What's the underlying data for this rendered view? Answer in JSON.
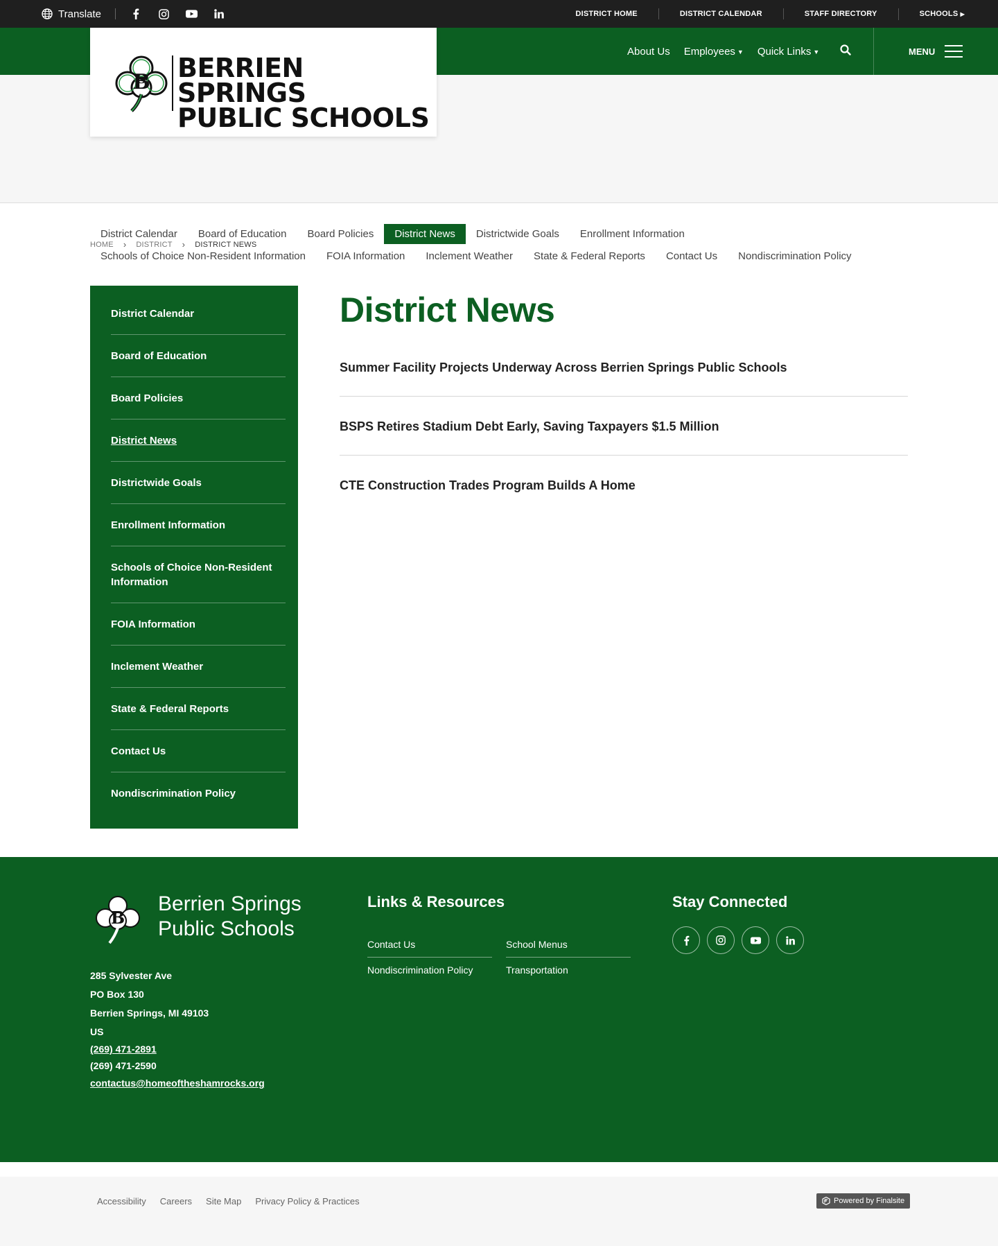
{
  "topbar": {
    "translate_label": "Translate",
    "social_icons": [
      "facebook-icon",
      "instagram-icon",
      "youtube-icon",
      "linkedin-icon"
    ],
    "links": [
      "DISTRICT HOME",
      "DISTRICT CALENDAR",
      "STAFF DIRECTORY",
      "SCHOOLS"
    ]
  },
  "header": {
    "nav": [
      "About Us",
      "Employees",
      "Quick Links"
    ],
    "menu_label": "MENU"
  },
  "logo": {
    "line1": "BERRIEN SPRINGS",
    "line2": "PUBLIC SCHOOLS"
  },
  "subnav": {
    "row1": [
      "District Calendar",
      "Board of Education",
      "Board Policies",
      "District News",
      "Districtwide Goals",
      "Enrollment Information"
    ],
    "row2": [
      "Schools of Choice Non-Resident Information",
      "FOIA Information",
      "Inclement Weather",
      "State & Federal Reports",
      "Contact Us",
      "Nondiscrimination Policy"
    ]
  },
  "breadcrumb": [
    "HOME",
    "DISTRICT",
    "DISTRICT NEWS"
  ],
  "sidebar": {
    "items": [
      "District Calendar",
      "Board of Education",
      "Board Policies",
      "District News",
      "Districtwide Goals",
      "Enrollment Information",
      "Schools of Choice Non-Resident Information",
      "FOIA Information",
      "Inclement Weather",
      "State & Federal Reports",
      "Contact Us",
      "Nondiscrimination Policy"
    ]
  },
  "main": {
    "title": "District News",
    "news": [
      "Summer Facility Projects Underway Across Berrien Springs Public Schools",
      "BSPS Retires Stadium Debt Early, Saving Taxpayers $1.5 Million",
      "CTE Construction Trades Program Builds A Home"
    ]
  },
  "footer": {
    "name_line1": "Berrien Springs",
    "name_line2": "Public Schools",
    "address": {
      "street": "285 Sylvester Ave",
      "pobox": "PO Box 130",
      "city": "Berrien Springs, MI  49103",
      "country": "US",
      "phone": "(269) 471-2891",
      "fax": "(269) 471-2590",
      "email": "contactus@homeoftheshamrocks.org"
    },
    "links_heading": "Links & Resources",
    "links": [
      "Contact Us",
      "School Menus",
      "Nondiscrimination Policy",
      "Transportation"
    ],
    "connect_heading": "Stay Connected"
  },
  "bottombar": {
    "links": [
      "Accessibility",
      "Careers",
      "Site Map",
      "Privacy Policy & Practices"
    ],
    "powered": "Powered by Finalsite"
  },
  "colors": {
    "brand_green": "#0c5f22",
    "topbar": "#1f1f1f"
  }
}
